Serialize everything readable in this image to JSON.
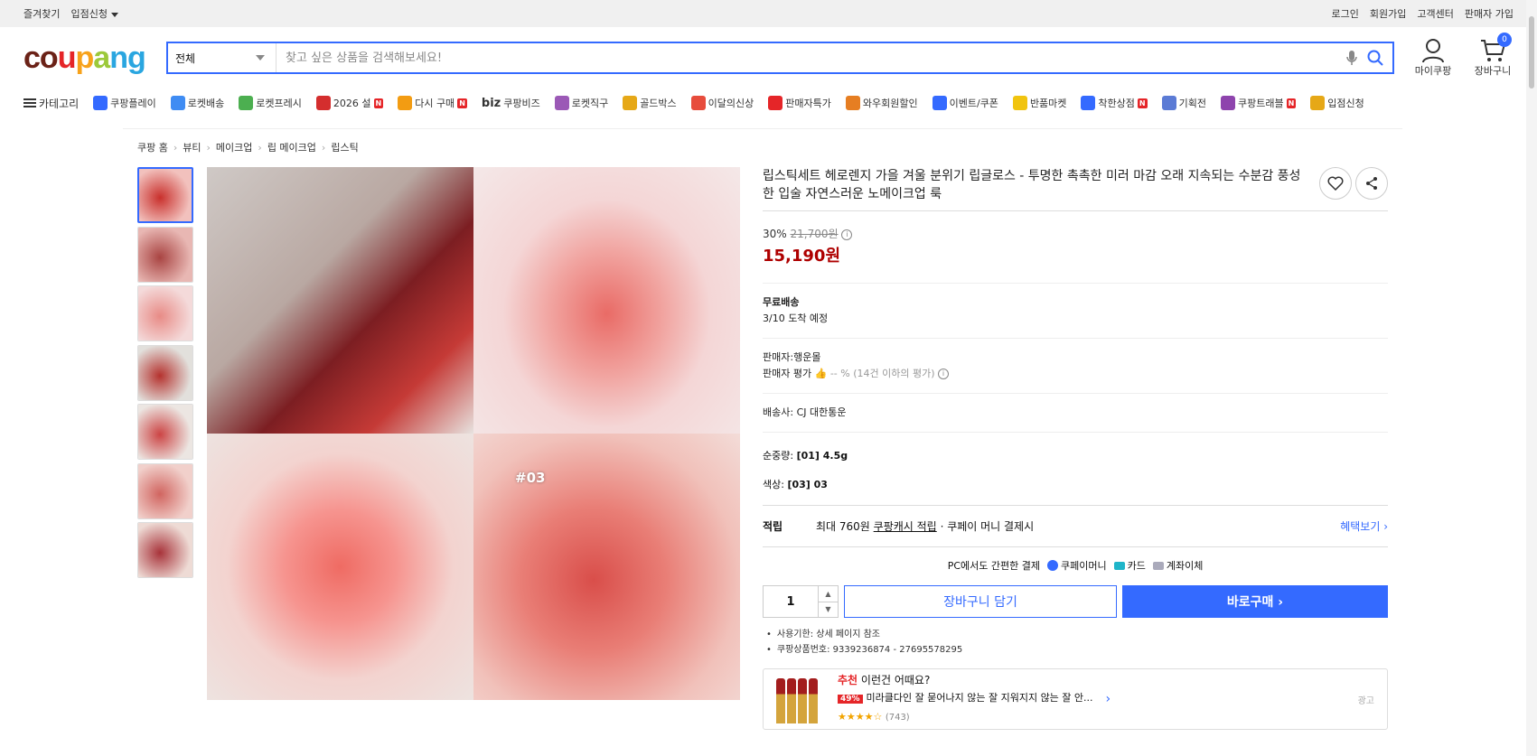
{
  "topbar": {
    "left": [
      "즐겨찾기",
      "입점신청"
    ],
    "right": [
      "로그인",
      "회원가입",
      "고객센터",
      "판매자 가입"
    ]
  },
  "header": {
    "logo": [
      "c",
      "o",
      "u",
      "p",
      "a",
      "n",
      "g"
    ],
    "logo_colors": [
      "#6b2217",
      "#6b2217",
      "#e52528",
      "#f7a21b",
      "#9cc93a",
      "#2aa6e0",
      "#2aa6e0"
    ],
    "search_category": "전체",
    "search_placeholder": "찾고 싶은 상품을 검색해보세요!",
    "mycoupang": "마이쿠팡",
    "cart": "장바구니",
    "cart_count": "0"
  },
  "nav": {
    "category": "카테고리",
    "items": [
      {
        "label": "쿠팡플레이",
        "color": "#346aff"
      },
      {
        "label": "로켓배송",
        "color": "#3f8cf3"
      },
      {
        "label": "로켓프레시",
        "color": "#4caf50"
      },
      {
        "label": "2026 설",
        "color": "#d42e2e",
        "badge": "N"
      },
      {
        "label": "다시 구매",
        "color": "#f39c12",
        "badge": "N"
      },
      {
        "label": "쿠팡비즈",
        "prefix": "biz",
        "color": "#333333"
      },
      {
        "label": "로켓직구",
        "color": "#9b59b6"
      },
      {
        "label": "골드박스",
        "color": "#e6a817"
      },
      {
        "label": "이달의신상",
        "color": "#e74c3c"
      },
      {
        "label": "판매자특가",
        "color": "#e52528"
      },
      {
        "label": "와우회원할인",
        "color": "#e67e22"
      },
      {
        "label": "이벤트/쿠폰",
        "color": "#346aff"
      },
      {
        "label": "반품마켓",
        "color": "#f1c40f"
      },
      {
        "label": "착한상점",
        "color": "#346aff",
        "badge": "N"
      },
      {
        "label": "기획전",
        "color": "#5b7bd5"
      },
      {
        "label": "쿠팡트래블",
        "color": "#8e44ad",
        "badge": "N"
      },
      {
        "label": "입점신청",
        "color": "#e6a817"
      }
    ]
  },
  "breadcrumb": [
    "쿠팡 홈",
    "뷰티",
    "메이크업",
    "립 메이크업",
    "립스틱"
  ],
  "gallery": {
    "thumb_colors": [
      [
        "#c9302c",
        "#f2c1bd"
      ],
      [
        "#a94442",
        "#e8b7b3"
      ],
      [
        "#e88b86",
        "#f4dada"
      ],
      [
        "#b5322e",
        "#e2e0dc"
      ],
      [
        "#c44",
        "#ece6e2"
      ],
      [
        "#d16560",
        "#f1d0cb"
      ],
      [
        "#a8333a",
        "#eedbd5"
      ]
    ],
    "image_label": "#03"
  },
  "product": {
    "title": "립스틱세트 헤로렌지 가을 겨울 분위기 립글로스 - 투명한 촉촉한 미러 마감 오래 지속되는 수분감 풍성한 입술 자연스러운 노메이크업 룩",
    "discount": "30%",
    "original_price": "21,700원",
    "sale_price": "15,190원",
    "shipping_label": "무료배송",
    "arrival": "3/10 도착 예정",
    "seller_label": "판매자:",
    "seller": "행운몰",
    "seller_rating_label": "판매자 평가",
    "seller_rating": "-- % (14건 이하의 평가)",
    "carrier_label": "배송사:",
    "carrier": "CJ 대한통운",
    "weight_label": "순중량:",
    "weight": "[01] 4.5g",
    "color_label": "색상:",
    "color": "[03] 03",
    "reward_label": "적립",
    "reward_text": "최대 760원",
    "reward_link": "쿠팡캐시 적립",
    "reward_suffix": "· 쿠페이 머니 결제시",
    "reward_more": "혜택보기 ›",
    "pay_title": "PC에서도 간편한 결제",
    "pay_methods": [
      "쿠페이머니",
      "카드",
      "계좌이체"
    ],
    "quantity": "1",
    "cart_button": "장바구니 담기",
    "buy_button": "바로구매 ›",
    "bullets": [
      "사용기한: 상세 페이지 참조",
      "쿠팡상품번호: 9339236874 - 27695578295"
    ]
  },
  "recommend": {
    "head_red": "추천",
    "head": "이런건 어때요?",
    "badge": "49%",
    "text": "미라클다인 잘 묻어나지 않는 잘 지워지지 않는 잘 안...",
    "stars": "★★★★☆",
    "count": "(743)",
    "ad": "광고"
  }
}
